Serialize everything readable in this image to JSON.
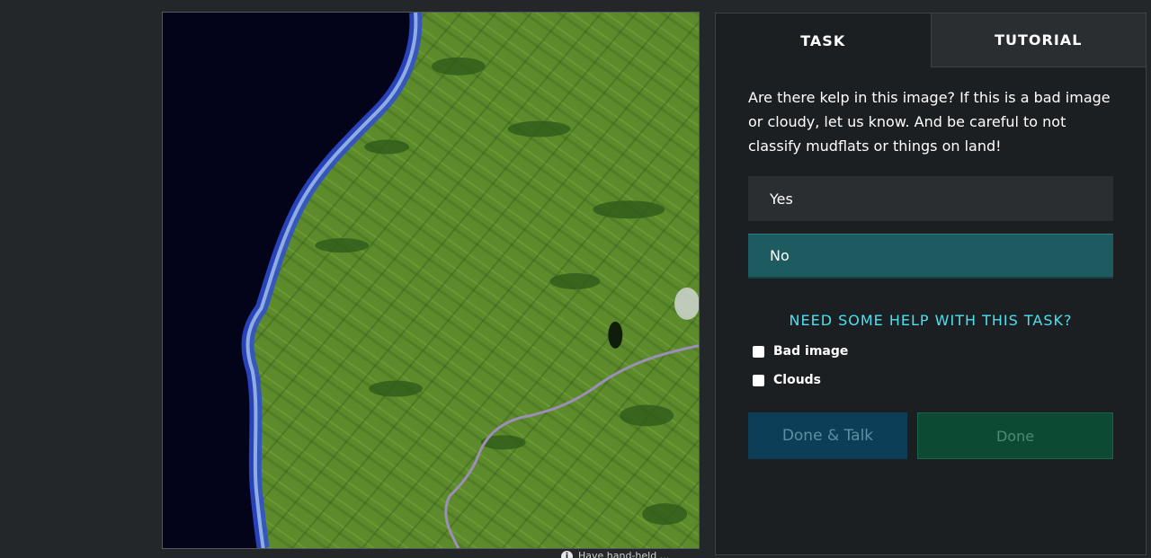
{
  "tabs": [
    {
      "label": "TASK",
      "active": true
    },
    {
      "label": "TUTORIAL",
      "active": false
    }
  ],
  "task": {
    "question": "Are there kelp in this image? If this is a bad image or cloudy, let us know. And be careful to not classify mudflats or things on land!",
    "answers": [
      {
        "label": "Yes",
        "selected": false
      },
      {
        "label": "No",
        "selected": true
      }
    ],
    "help_link": "NEED SOME HELP WITH THIS TASK?",
    "checkboxes": [
      {
        "label": "Bad image",
        "checked": false
      },
      {
        "label": "Clouds",
        "checked": false
      }
    ]
  },
  "actions": {
    "done_talk": "Done & Talk",
    "done": "Done"
  },
  "footer": {
    "info_text": "Have hand-held ..."
  },
  "colors": {
    "page_bg": "#23272a",
    "panel_bg": "#1c1f21",
    "selected_answer": "#1d5b60",
    "help_link": "#4ee0f0",
    "done_talk_bg": "#0d3e57",
    "done_bg": "#0c4a33",
    "land": "#5d8a2b",
    "ocean": "#03031a"
  }
}
